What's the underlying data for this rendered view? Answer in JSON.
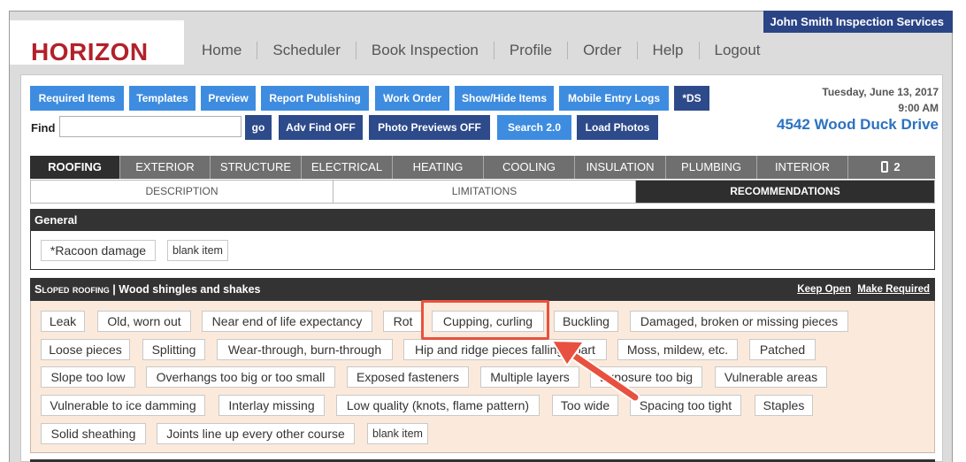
{
  "header": {
    "company": "John Smith Inspection Services",
    "logo": "HORIZON",
    "nav": [
      "Home",
      "Scheduler",
      "Book Inspection",
      "Profile",
      "Order",
      "Help",
      "Logout"
    ]
  },
  "toolbar": {
    "row1": [
      "Required Items",
      "Templates",
      "Preview",
      "Report Publishing",
      "Work Order",
      "Show/Hide Items",
      "Mobile Entry Logs",
      "*DS"
    ],
    "find_label": "Find",
    "find_value": "",
    "go": "go",
    "adv_find": "Adv Find OFF",
    "photo_previews": "Photo Previews OFF",
    "search": "Search 2.0",
    "load_photos": "Load Photos"
  },
  "inspection": {
    "date": "Tuesday, June 13, 2017",
    "time": "9:00 AM",
    "address": "4542 Wood Duck Drive"
  },
  "tabs": [
    "ROOFING",
    "EXTERIOR",
    "STRUCTURE",
    "ELECTRICAL",
    "HEATING",
    "COOLING",
    "INSULATION",
    "PLUMBING",
    "INTERIOR",
    "2"
  ],
  "subtabs": [
    "DESCRIPTION",
    "LIMITATIONS",
    "RECOMMENDATIONS"
  ],
  "general": {
    "title": "General",
    "items": [
      "*Racoon damage",
      "blank item"
    ]
  },
  "sloped": {
    "title_smallcaps": "Sloped roofing",
    "title_rest": " | Wood shingles and shakes",
    "keep_open": "Keep Open",
    "make_required": "Make Required",
    "rows": [
      [
        "Leak",
        "Old, worn out",
        "Near end of life expectancy",
        "Rot",
        "Cupping, curling",
        "Buckling",
        "Damaged, broken or missing pieces"
      ],
      [
        "Loose pieces",
        "Splitting",
        "Wear-through, burn-through",
        "Hip and ridge pieces falling apart",
        "Moss, mildew, etc.",
        "Patched"
      ],
      [
        "Slope too low",
        "Overhangs too big or too small",
        "Exposed fasteners",
        "Multiple layers",
        "Exposure too big",
        "Vulnerable areas"
      ],
      [
        "Vulnerable to ice damming",
        "Interlay missing",
        "Low quality (knots, flame pattern)",
        "Too wide",
        "Spacing too tight",
        "Staples"
      ],
      [
        "Solid sheathing",
        "Joints line up every other course",
        "blank item"
      ]
    ]
  },
  "colors": {
    "logo_red": "#b2212a",
    "company_bar": "#2a4486",
    "button_blue": "#3e8ce0",
    "button_navy": "#2d4a8a",
    "address_blue": "#2c72c0",
    "highlight_red": "#e8513f",
    "sloped_bg": "#fbeadb"
  },
  "icons": {
    "tab_last": "phone-icon"
  }
}
